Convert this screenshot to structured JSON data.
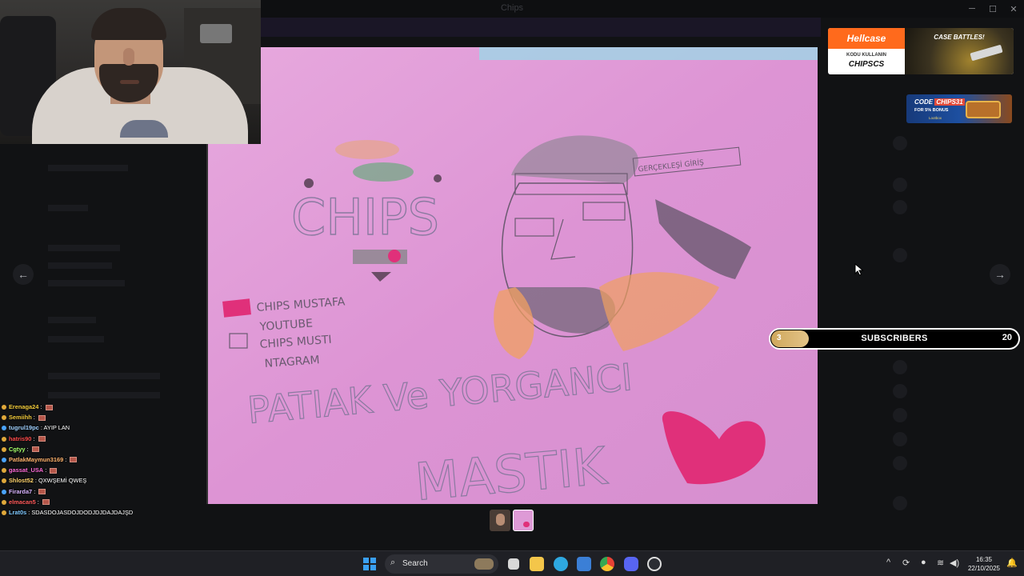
{
  "window": {
    "title": "Chips",
    "minimize": "─",
    "maximize": "☐",
    "close": "✕"
  },
  "banner": {
    "text": "",
    "button": ""
  },
  "chat": [
    {
      "user": "Erenaga24",
      "color": "#f0c93a",
      "message": ""
    },
    {
      "user": "Semiihh",
      "color": "#f0c93a",
      "message": ""
    },
    {
      "user": "tugrul19pc",
      "color": "#9fd0ff",
      "message": "AYIP LAN"
    },
    {
      "user": "hatris90",
      "color": "#ff4a4a",
      "message": ""
    },
    {
      "user": "Cgtyy",
      "color": "#a6ff6b",
      "message": ""
    },
    {
      "user": "PatlakMaymun3169",
      "color": "#ffb26b",
      "message": ""
    },
    {
      "user": "gassat_USA",
      "color": "#ff6bd8",
      "message": ""
    },
    {
      "user": "Shlost52",
      "color": "#ffd36b",
      "message": "QXWŞEMİ QWEŞ"
    },
    {
      "user": "Firarda7",
      "color": "#d6b3ff",
      "message": ""
    },
    {
      "user": "elmacan5",
      "color": "#ff5a5a",
      "message": ""
    },
    {
      "user": "Lrat0s",
      "color": "#7ec8ff",
      "message": "SDASDOJASDOJDODJDJDAJDAJŞD"
    }
  ],
  "viewer": {
    "prev_icon": "arrow-left-icon",
    "next_icon": "arrow-right-icon",
    "prev_glyph": "←",
    "next_glyph": "→"
  },
  "drawing": {
    "word_chips": "CHIPS",
    "line1": "CHIPS MUSTAFA",
    "line2": "YOUTUBE",
    "line3": "CHIPS MUSTI",
    "line4": "NTAGRAM",
    "phrase": "PATIAK Ve YORGANCI",
    "name": "MASTIK",
    "headband": "GERÇEKLEŞİ GİRİŞ"
  },
  "ads": {
    "hellcase_brand": "Hellcase",
    "hellcase_line1": "KODU KULLANIN",
    "hellcase_code": "CHIPSCS",
    "hellcase_promo": "CASE BATTLES!",
    "lootbox_code_prefix": "CODE",
    "lootbox_code": "CHIPS31",
    "lootbox_bonus": "FOR 5% BONUS",
    "lootbox_brand": "Lootbox"
  },
  "subscribers": {
    "current": "3",
    "label": "SUBSCRIBERS",
    "goal": "20",
    "progress": 0.15
  },
  "taskbar": {
    "search_label": "Search",
    "time": "16:35",
    "date": "22/10/2025"
  },
  "colors": {
    "paper": "#de9ad6",
    "accent_orange": "#ff6a1c",
    "subs_fill": "#cfa75c"
  }
}
